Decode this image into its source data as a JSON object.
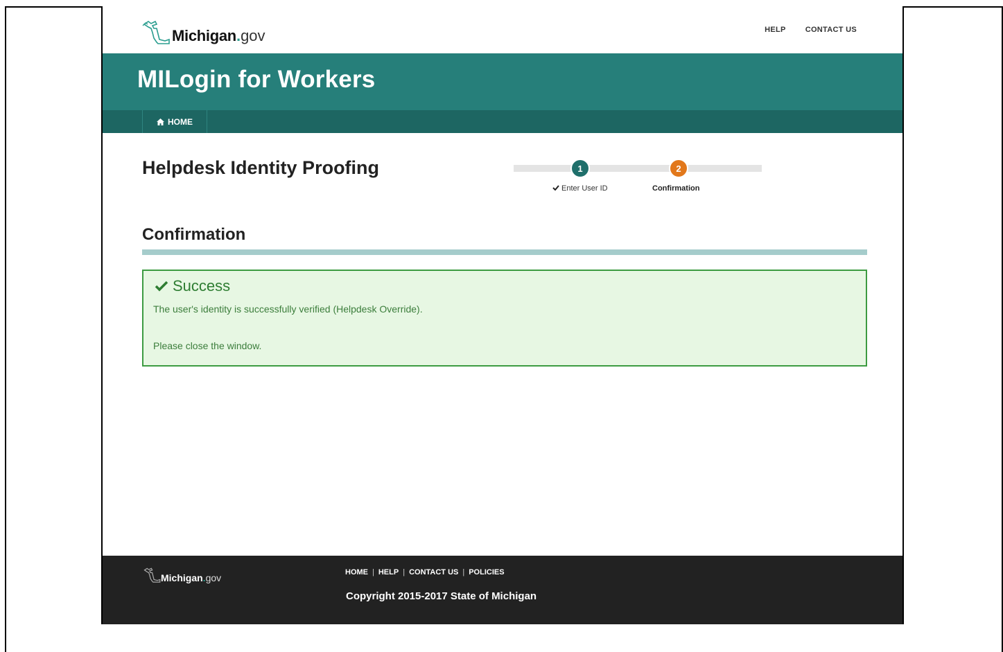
{
  "header": {
    "logo_name": "Michigan",
    "logo_dot": ".",
    "logo_suffix": "gov",
    "links": {
      "help": "HELP",
      "contact": "CONTACT US"
    }
  },
  "banner": {
    "title": "MILogin for Workers"
  },
  "nav": {
    "home_label": "HOME"
  },
  "page": {
    "title": "Helpdesk Identity Proofing"
  },
  "stepper": {
    "steps": [
      {
        "number": "1",
        "label": "Enter User ID",
        "status": "complete"
      },
      {
        "number": "2",
        "label": "Confirmation",
        "status": "current"
      }
    ]
  },
  "section": {
    "title": "Confirmation",
    "alert": {
      "heading": "Success",
      "message": "The user's identity is successfully verified (Helpdesk Override).",
      "instruction": "Please close the window."
    }
  },
  "footer": {
    "logo_name": "Michigan",
    "logo_dot": ".",
    "logo_suffix": "gov",
    "links": {
      "home": "HOME",
      "help": "HELP",
      "contact": "CONTACT US",
      "policies": "POLICIES"
    },
    "separator": "|",
    "copyright": "Copyright 2015-2017 State of Michigan"
  },
  "colors": {
    "banner": "#267f7a",
    "navbar": "#1d6662",
    "step_complete": "#1f6f6b",
    "step_current": "#e2781b",
    "success_border": "#3c9b41",
    "success_bg": "#e7f7e3",
    "footer": "#222222"
  },
  "icons": {
    "logo": "michigan-outline-icon",
    "home": "home-icon",
    "check": "checkmark-icon"
  }
}
